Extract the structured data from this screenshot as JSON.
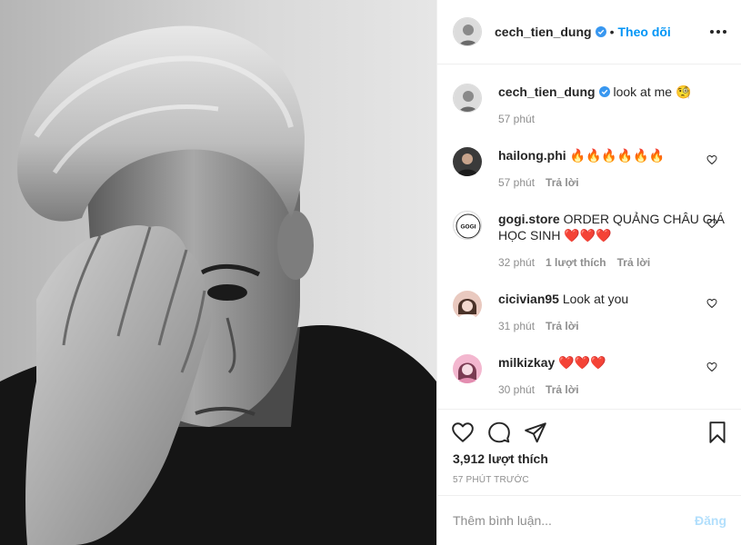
{
  "header": {
    "username": "cech_tien_dung",
    "separator": "•",
    "follow_label": "Theo dõi"
  },
  "caption": {
    "username": "cech_tien_dung",
    "text": "look at me 🧐",
    "time": "57 phút"
  },
  "comments": [
    {
      "username": "hailong.phi",
      "text": "🔥🔥🔥🔥🔥🔥",
      "time": "57 phút",
      "likes": "",
      "reply": "Trả lời",
      "avatar_color": "#3a3a3a"
    },
    {
      "username": "gogi.store",
      "text": "ORDER QUẢNG CHÂU GIÁ HỌC SINH ❤️❤️❤️",
      "time": "32 phút",
      "likes": "1 lượt thích",
      "reply": "Trả lời",
      "avatar_text": "GOGI"
    },
    {
      "username": "cicivian95",
      "text": "Look at you",
      "time": "31 phút",
      "likes": "",
      "reply": "Trả lời",
      "avatar_color": "#e9c9bf"
    },
    {
      "username": "milkizkay",
      "text": "❤️❤️❤️",
      "time": "30 phút",
      "likes": "",
      "reply": "Trả lời",
      "avatar_color": "#f3b7cf"
    }
  ],
  "actions": {
    "likes": "3,912 lượt thích",
    "time_ago": "57 PHÚT TRƯỚC"
  },
  "add_comment": {
    "placeholder": "Thêm bình luận...",
    "post_label": "Đăng"
  },
  "colors": {
    "link_blue": "#0095f6",
    "post_disabled": "#b2dffc",
    "muted": "#8e8e8e",
    "verified": "#3897f0"
  }
}
